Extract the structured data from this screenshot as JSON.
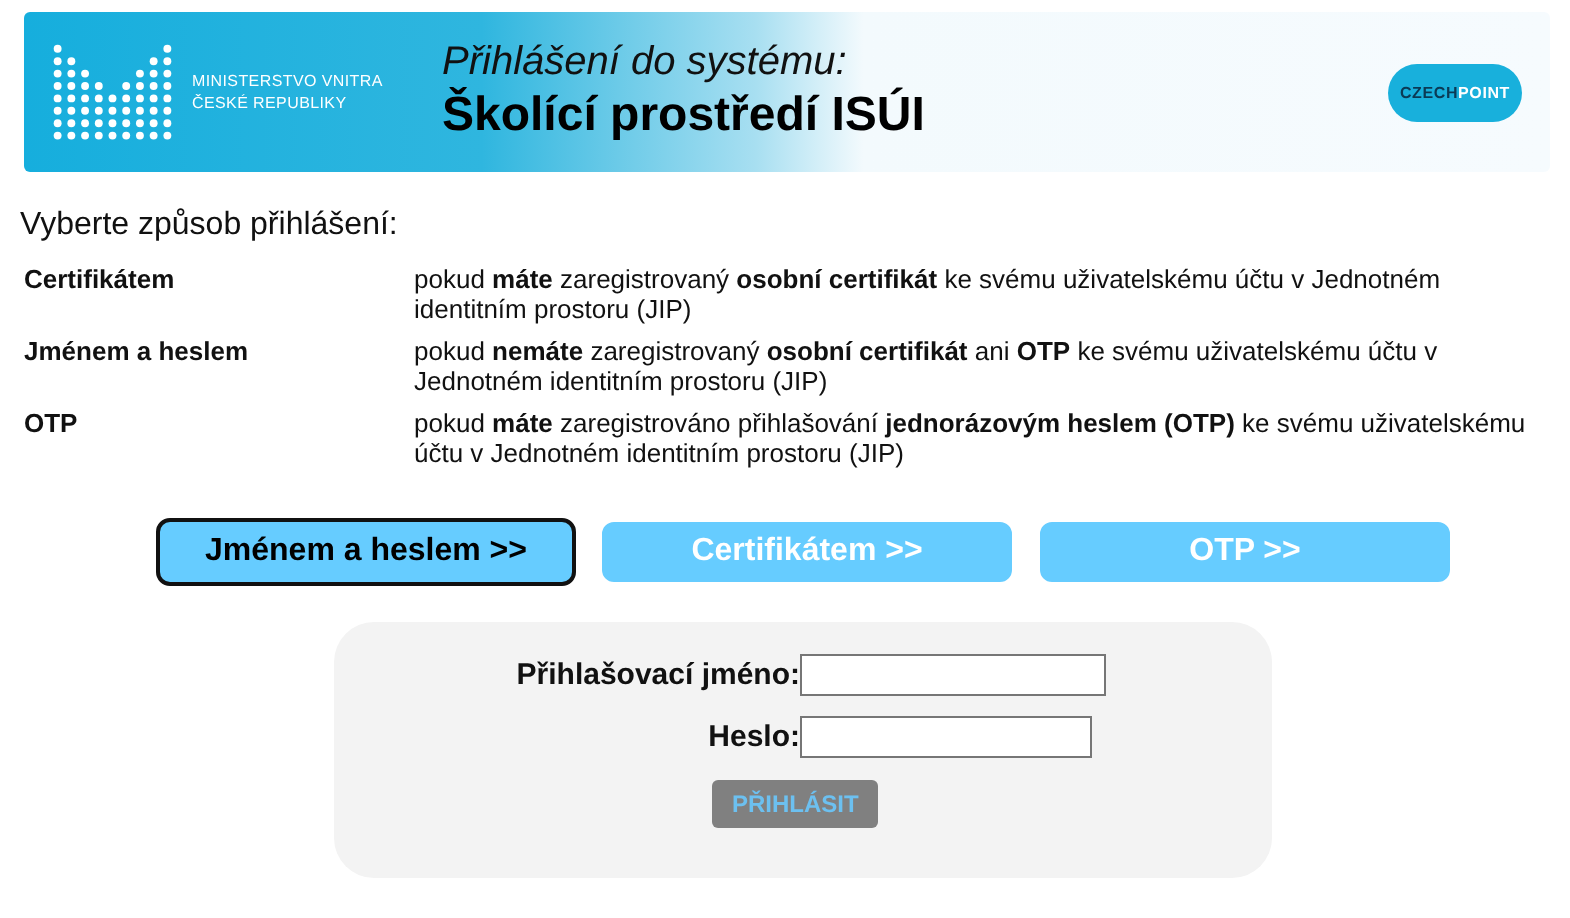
{
  "header": {
    "ministry": [
      "MINISTERSTVO VNITRA",
      "ČESKÉ REPUBLIKY"
    ],
    "subtitle": "Přihlášení do systému:",
    "title": "Školící prostředí ISÚI",
    "brand": {
      "part_1": "CZECH",
      "part_2": "POINT"
    }
  },
  "prompt": "Vyberte způsob přihlášení:",
  "methods": [
    {
      "name": "Certifikátem",
      "description": "pokud **máte** zaregistrovaný **osobní certifikát** ke svému uživatelskému účtu v Jednotném identitním prostoru (JIP)"
    },
    {
      "name": "Jménem a heslem",
      "description": "pokud **nemáte** zaregistrovaný **osobní certifikát** ani **OTP** ke svému uživatelskému účtu v Jednotném identitním prostoru (JIP)"
    },
    {
      "name": "OTP",
      "description": "pokud **máte** zaregistrováno přihlašování **jednorázovým heslem (OTP)** ke svému uživatelskému účtu v Jednotném identitním prostoru (JIP)"
    }
  ],
  "buttons": [
    {
      "label": "Jménem a heslem >>",
      "selected": true
    },
    {
      "label": "Certifikátem >>",
      "selected": false
    },
    {
      "label": "OTP >>",
      "selected": false
    }
  ],
  "form": {
    "fields": [
      {
        "label": "Přihlašovací jméno:",
        "kind": "text"
      },
      {
        "label": "Heslo:",
        "kind": "password"
      }
    ],
    "submit": {
      "label": "PŘIHLÁSIT",
      "disabled": true
    }
  }
}
